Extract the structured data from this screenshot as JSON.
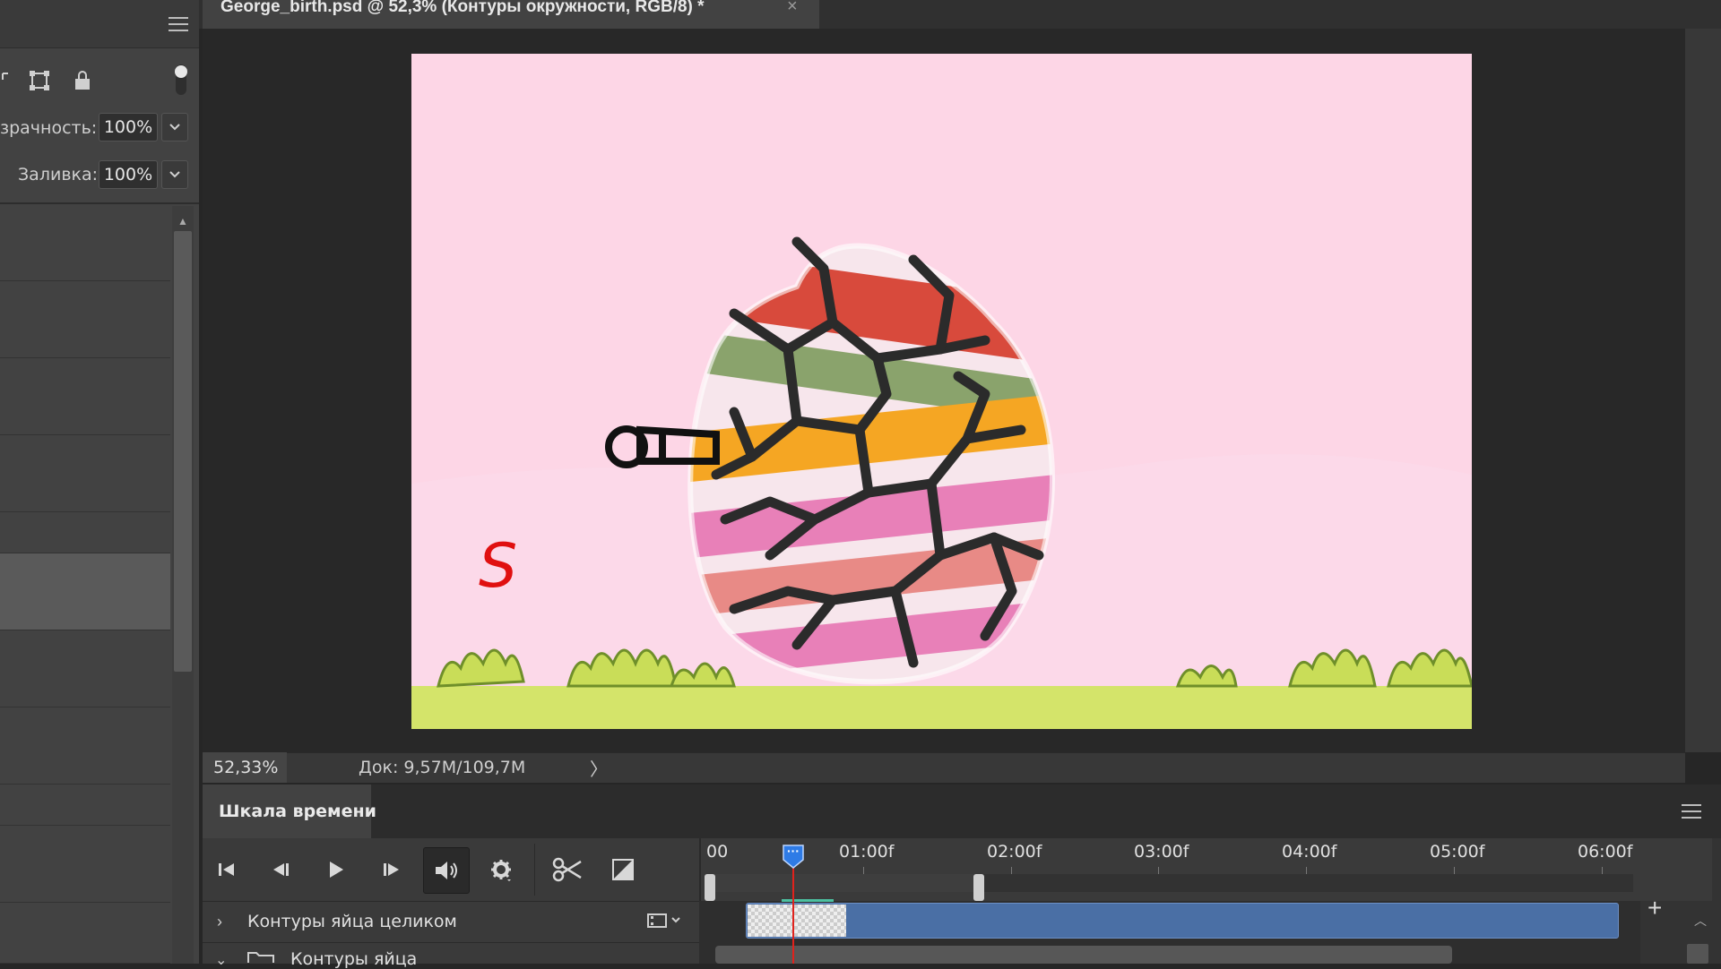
{
  "document": {
    "tab_title": "George_birth.psd @ 52,3% (Контуры окружности, RGB/8) *",
    "close_glyph": "×"
  },
  "layers_panel": {
    "opacity_label": "зрачность:",
    "opacity_value": "100%",
    "fill_label": "Заливка:",
    "fill_value": "100%"
  },
  "status_bar": {
    "zoom": "52,33%",
    "doc_info": "Док: 9,57M/109,7M",
    "arrow": "〉"
  },
  "timeline": {
    "tab_title": "Шкала времени",
    "time_labels": [
      "00",
      "01:00f",
      "02:00f",
      "03:00f",
      "04:00f",
      "05:00f",
      "06:00f"
    ],
    "track_name": "Контуры яйца целиком",
    "group_name": "Контуры яйца",
    "playhead_label": "···"
  },
  "canvas_art": {
    "annotation_letter": "S",
    "colors": {
      "background_pink": "#fdd6e6",
      "grass": "#d4e46a",
      "stripe_red": "#d84a3c",
      "stripe_green": "#8aa36c",
      "stripe_orange": "#f5a623",
      "stripe_pink": "#e880b8",
      "crack": "#2b2b2b"
    }
  },
  "icons": {
    "panel_menu": "hamburger-icon",
    "first_frame": "skip-to-start-icon",
    "prev_frame": "prev-frame-icon",
    "play": "play-icon",
    "next_frame": "next-frame-icon",
    "audio": "speaker-icon",
    "settings": "gear-icon",
    "split": "scissors-icon",
    "transition": "transition-icon"
  }
}
